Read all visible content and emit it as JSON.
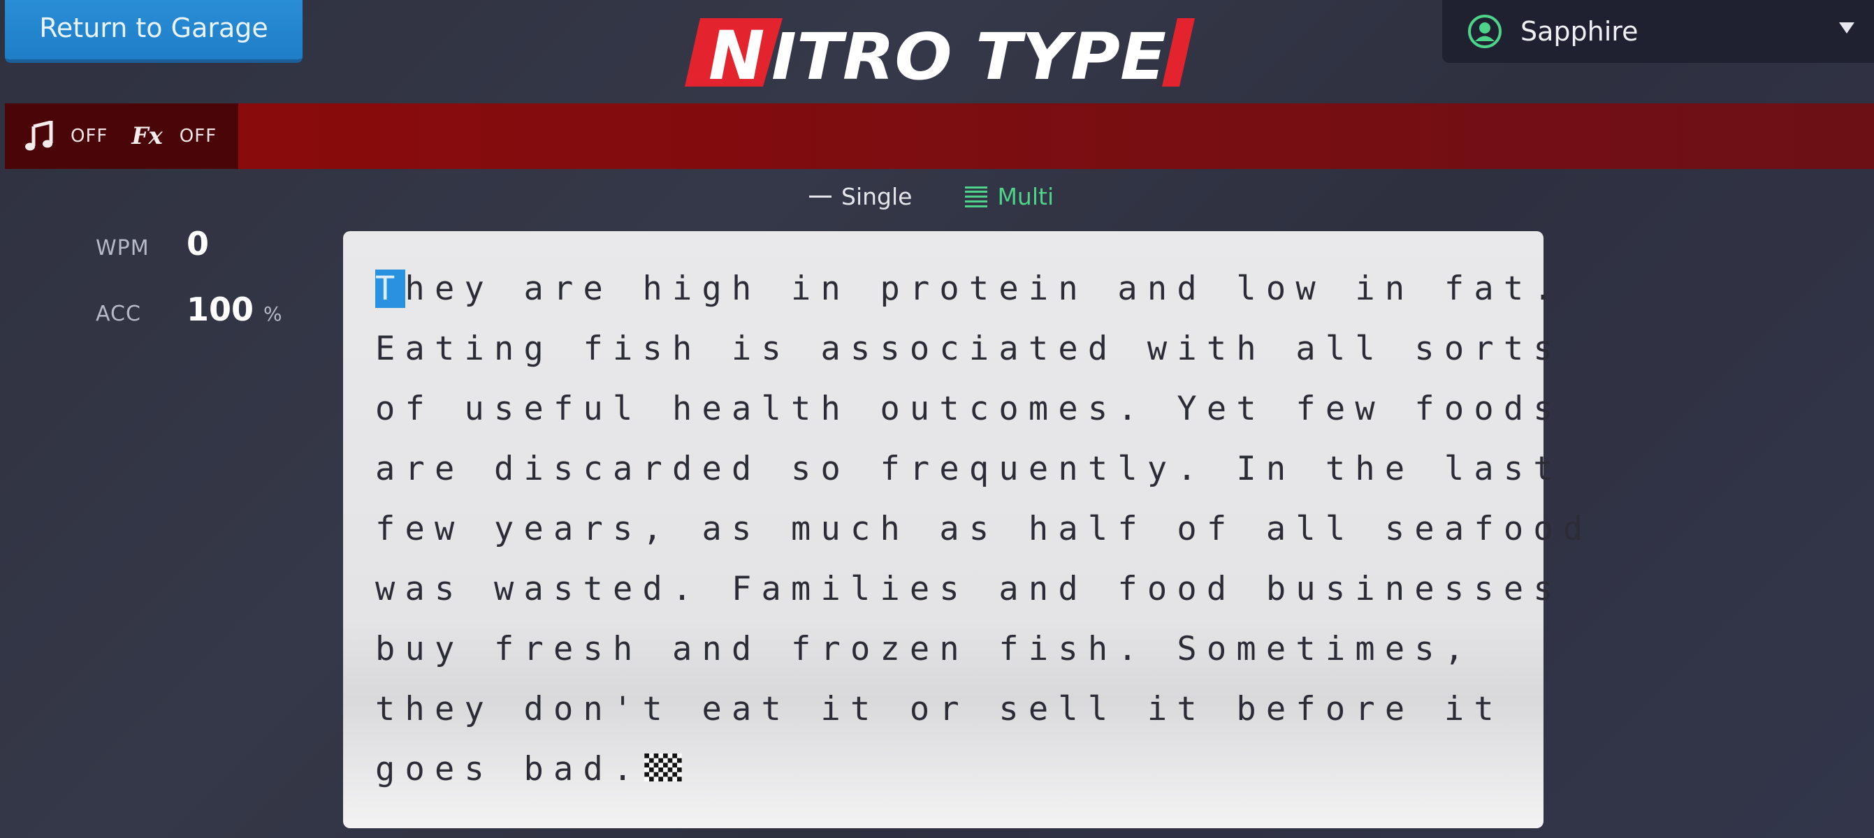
{
  "header": {
    "return_label": "Return to Garage",
    "logo_text": "NITRO TYPE",
    "user": {
      "name": "Sapphire",
      "avatar_icon": "user-circle-icon"
    }
  },
  "sound": {
    "music": {
      "icon": "music-note-icon",
      "state": "OFF"
    },
    "fx": {
      "icon": "fx-icon",
      "icon_text": "Fx",
      "state": "OFF"
    }
  },
  "mode": {
    "single_label": "Single",
    "multi_label": "Multi",
    "active": "Multi"
  },
  "stats": {
    "wpm_label": "WPM",
    "wpm_value": "0",
    "acc_label": "ACC",
    "acc_value": "100",
    "acc_unit": "%"
  },
  "race": {
    "cursor_char": "T",
    "lines": [
      "hey are high in protein and low in fat.",
      "Eating fish is associated with all sorts",
      "of useful health outcomes. Yet few foods",
      "are discarded so frequently. In the last",
      "few years, as much as half of all seafood",
      "was wasted. Families and food businesses",
      "buy fresh and frozen fish. Sometimes,",
      "they don't eat it or sell it before it",
      "goes bad."
    ],
    "finish_icon": "checkered-flag-icon"
  },
  "colors": {
    "accent_blue": "#2891e0",
    "accent_green": "#4ed38a",
    "brand_red": "#e3242f",
    "bar_red": "#8f0a0a"
  }
}
